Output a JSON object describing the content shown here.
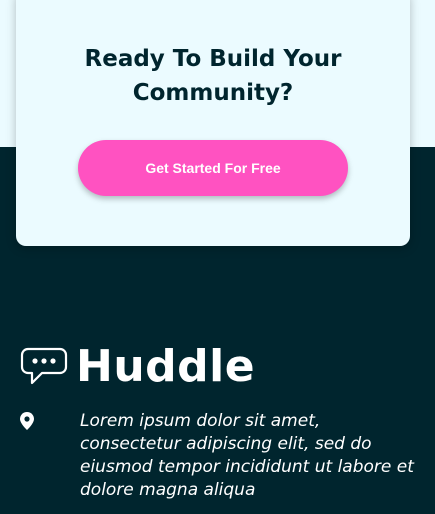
{
  "cta": {
    "title": "Ready To Build Your Community?",
    "button_label": "Get Started For Free"
  },
  "footer": {
    "brand_name": "Huddle",
    "brand_icon": "chat-bubble-icon",
    "location_icon": "location-pin-icon",
    "address": "Lorem ipsum dolor sit amet, consectetur adipiscing elit, sed do eiusmod tempor incididunt ut labore et dolore magna aliqua"
  },
  "colors": {
    "light_bg": "#ebfbff",
    "dark_bg": "#00252e",
    "accent_pink": "#ff52c1",
    "white": "#ffffff"
  }
}
